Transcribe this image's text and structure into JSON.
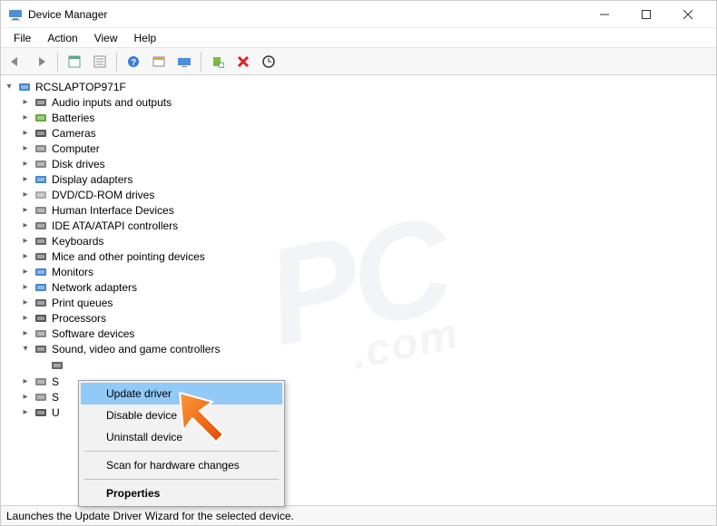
{
  "window": {
    "title": "Device Manager"
  },
  "menubar": {
    "items": [
      "File",
      "Action",
      "View",
      "Help"
    ]
  },
  "toolbar": {
    "buttons": [
      {
        "name": "back-icon"
      },
      {
        "name": "forward-icon"
      },
      {
        "sep": true
      },
      {
        "name": "properties-page-icon"
      },
      {
        "name": "details-pane-icon"
      },
      {
        "sep": true
      },
      {
        "name": "help-icon"
      },
      {
        "name": "action-log-icon"
      },
      {
        "name": "show-hidden-icon"
      },
      {
        "sep": true
      },
      {
        "name": "scan-hardware-icon"
      },
      {
        "name": "remove-device-icon"
      },
      {
        "name": "update-driver-toolbar-icon"
      }
    ]
  },
  "tree": {
    "root": {
      "label": "RCSLAPTOP971F",
      "icon": "computer-icon",
      "expanded": true
    },
    "categories": [
      {
        "label": "Audio inputs and outputs",
        "icon": "speaker-icon",
        "expanded": false
      },
      {
        "label": "Batteries",
        "icon": "battery-icon",
        "expanded": false
      },
      {
        "label": "Cameras",
        "icon": "camera-icon",
        "expanded": false
      },
      {
        "label": "Computer",
        "icon": "pc-icon",
        "expanded": false
      },
      {
        "label": "Disk drives",
        "icon": "disk-icon",
        "expanded": false
      },
      {
        "label": "Display adapters",
        "icon": "display-icon",
        "expanded": false
      },
      {
        "label": "DVD/CD-ROM drives",
        "icon": "cdrom-icon",
        "expanded": false
      },
      {
        "label": "Human Interface Devices",
        "icon": "hid-icon",
        "expanded": false
      },
      {
        "label": "IDE ATA/ATAPI controllers",
        "icon": "ide-icon",
        "expanded": false
      },
      {
        "label": "Keyboards",
        "icon": "keyboard-icon",
        "expanded": false
      },
      {
        "label": "Mice and other pointing devices",
        "icon": "mouse-icon",
        "expanded": false
      },
      {
        "label": "Monitors",
        "icon": "monitor-icon",
        "expanded": false
      },
      {
        "label": "Network adapters",
        "icon": "network-icon",
        "expanded": false
      },
      {
        "label": "Print queues",
        "icon": "printer-icon",
        "expanded": false
      },
      {
        "label": "Processors",
        "icon": "cpu-icon",
        "expanded": false
      },
      {
        "label": "Software devices",
        "icon": "software-icon",
        "expanded": false
      },
      {
        "label": "Sound, video and game controllers",
        "icon": "sound-icon",
        "expanded": true
      },
      {
        "label": "S",
        "icon": "storage-icon",
        "expanded": false,
        "truncated": true
      },
      {
        "label": "S",
        "icon": "system-icon",
        "expanded": false,
        "truncated": true
      },
      {
        "label": "U",
        "icon": "usb-icon",
        "expanded": false,
        "truncated": true
      }
    ],
    "sound_child_placeholder": ""
  },
  "context_menu": {
    "items": [
      {
        "label": "Update driver",
        "highlight": true
      },
      {
        "label": "Disable device"
      },
      {
        "label": "Uninstall device"
      },
      {
        "sep": true
      },
      {
        "label": "Scan for hardware changes"
      },
      {
        "sep": true
      },
      {
        "label": "Properties",
        "bold": true
      }
    ]
  },
  "statusbar": {
    "text": "Launches the Update Driver Wizard for the selected device."
  },
  "watermark": {
    "main": "PC",
    "sub": ".com"
  }
}
